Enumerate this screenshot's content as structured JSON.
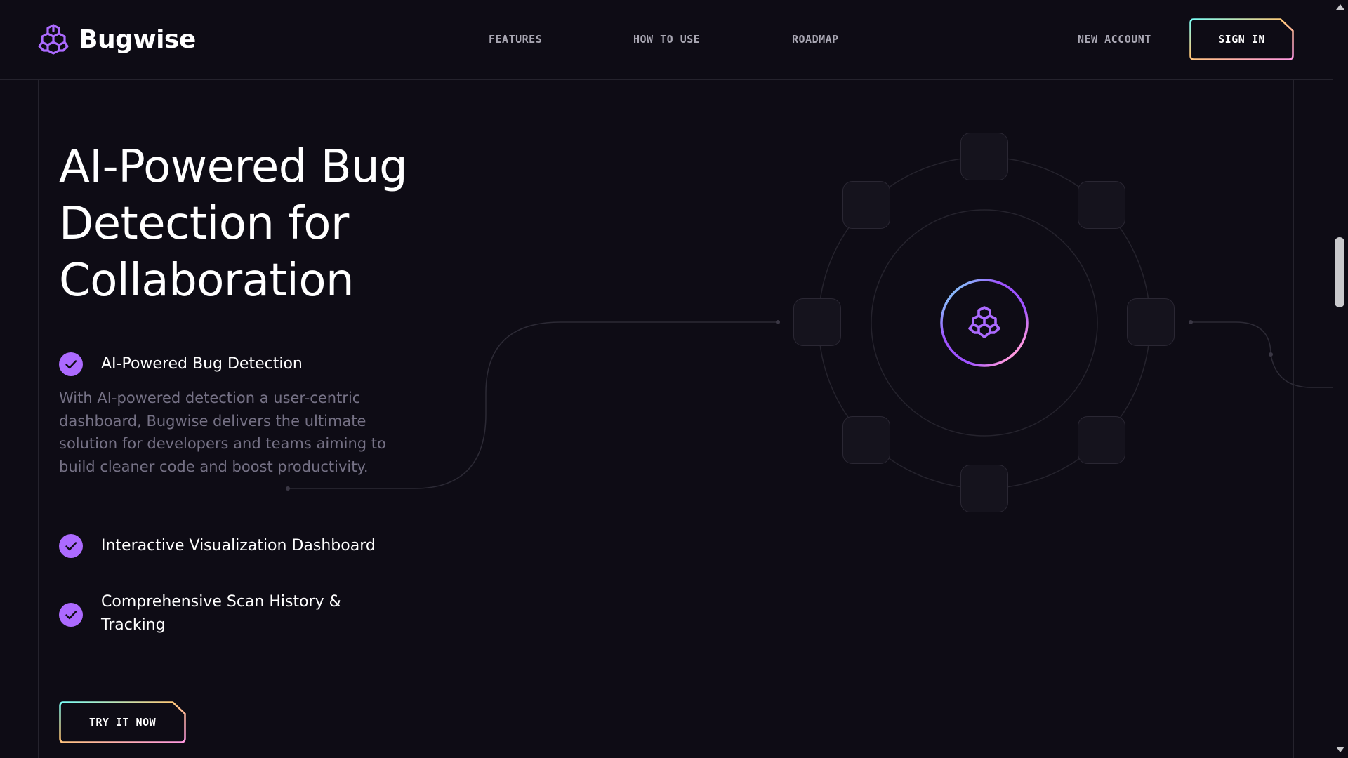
{
  "brand": {
    "name": "Bugwise",
    "logo_icon": "brain-icon",
    "accent": "#ac6aff"
  },
  "nav": {
    "items": [
      {
        "label": "FEATURES"
      },
      {
        "label": "HOW TO USE"
      },
      {
        "label": "ROADMAP"
      }
    ],
    "new_account": "NEW ACCOUNT",
    "sign_in": "SIGN IN"
  },
  "hero": {
    "title": "AI-Powered Bug Detection for Collaboration",
    "features": [
      {
        "label": "AI-Powered Bug Detection",
        "description": "With AI-powered detection a user-centric dashboard, Bugwise delivers the ultimate solution for developers and teams aiming to build cleaner code and boost productivity."
      },
      {
        "label": "Interactive Visualization Dashboard"
      },
      {
        "label": "Comprehensive Scan History & Tracking"
      }
    ],
    "cta": "TRY IT NOW"
  },
  "colors": {
    "background": "#0e0c15",
    "check": "#ac6aff",
    "text_muted": "#757185",
    "nav_text": "#a9a7b3",
    "gradient": [
      "#ffc876",
      "#79fff7",
      "#9f53ff",
      "#ff98e2"
    ]
  }
}
